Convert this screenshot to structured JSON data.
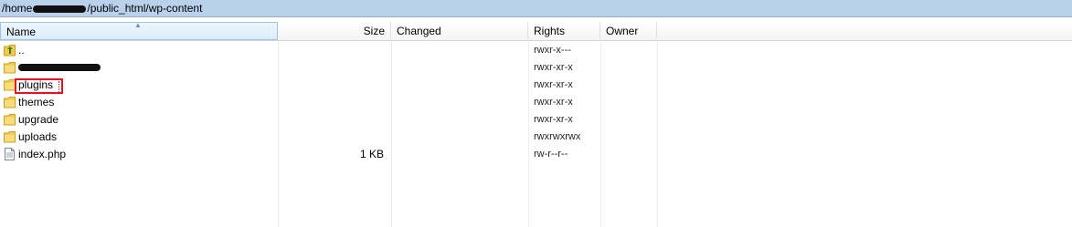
{
  "path_bar": {
    "prefix": "/home",
    "suffix": "/public_html/wp-content"
  },
  "columns": {
    "name": "Name",
    "size": "Size",
    "changed": "Changed",
    "rights": "Rights",
    "owner": "Owner"
  },
  "rows": [
    {
      "name": "..",
      "size": "",
      "rights": "rwxr-x---",
      "icon": "folder-up-icon"
    },
    {
      "name": "",
      "size": "",
      "rights": "rwxr-xr-x",
      "icon": "folder-icon",
      "redacted": true
    },
    {
      "name": "plugins",
      "size": "",
      "rights": "rwxr-xr-x",
      "icon": "folder-icon",
      "highlighted": true
    },
    {
      "name": "themes",
      "size": "",
      "rights": "rwxr-xr-x",
      "icon": "folder-icon"
    },
    {
      "name": "upgrade",
      "size": "",
      "rights": "rwxr-xr-x",
      "icon": "folder-icon"
    },
    {
      "name": "uploads",
      "size": "",
      "rights": "rwxrwxrwx",
      "icon": "folder-icon"
    },
    {
      "name": "index.php",
      "size": "1 KB",
      "rights": "rw-r--r--",
      "icon": "file-icon"
    }
  ],
  "colors": {
    "path_bar": "#b9d1ea",
    "folder": "#f2c94c",
    "highlight": "#e0141e"
  }
}
